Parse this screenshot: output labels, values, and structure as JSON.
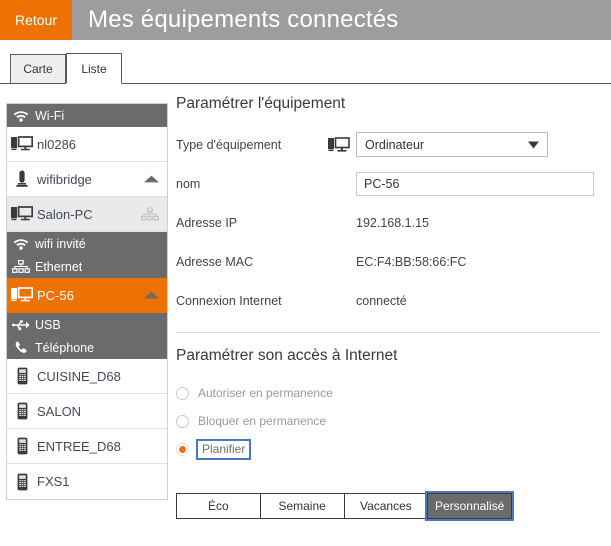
{
  "header": {
    "back_label": "Retour",
    "title": "Mes équipements connectés",
    "back_bg": "#ee7203",
    "bar_bg": "#9d9d9d"
  },
  "tabs": {
    "items": [
      {
        "label": "Carte",
        "active": false
      },
      {
        "label": "Liste",
        "active": true
      }
    ]
  },
  "sidebar": {
    "items": [
      {
        "label": "Wi-Fi",
        "icon": "wifi-icon",
        "kind": "group"
      },
      {
        "label": "nl0286",
        "icon": "computer-icon",
        "kind": "device"
      },
      {
        "label": "wifibridge",
        "icon": "bridge-icon",
        "kind": "device",
        "caret": "up"
      },
      {
        "label": "Salon-PC",
        "icon": "computer-icon",
        "kind": "device",
        "shade": true,
        "badge": "network-icon"
      },
      {
        "label": "wifi invité",
        "icon": "wifi-icon",
        "kind": "group"
      },
      {
        "label": "Ethernet",
        "icon": "network-icon",
        "kind": "group"
      },
      {
        "label": "PC-56",
        "icon": "computer-icon",
        "kind": "device",
        "selected": true,
        "caret": "up"
      },
      {
        "label": "USB",
        "icon": "usb-icon",
        "kind": "group"
      },
      {
        "label": "Téléphone",
        "icon": "phone-icon",
        "kind": "group"
      },
      {
        "label": "CUISINE_D68",
        "icon": "handset-icon",
        "kind": "device"
      },
      {
        "label": "SALON",
        "icon": "handset-icon",
        "kind": "device"
      },
      {
        "label": "ENTREE_D68",
        "icon": "handset-icon",
        "kind": "device"
      },
      {
        "label": "FXS1",
        "icon": "handset-icon",
        "kind": "device",
        "last": true
      }
    ]
  },
  "equipment": {
    "section_title": "Paramétrer l'équipement",
    "type_label": "Type d'équipement",
    "type_value": "Ordinateur",
    "type_options": [
      "Ordinateur"
    ],
    "name_label": "nom",
    "name_value": "PC-56",
    "name_placeholder": "",
    "ip_label": "Adresse IP",
    "ip_value": "192.168.1.15",
    "mac_label": "Adresse MAC",
    "mac_value": "EC:F4:BB:58:66:FC",
    "conn_label": "Connexion Internet",
    "conn_value": "connecté"
  },
  "internet": {
    "section_title": "Paramétrer son accès à Internet",
    "options": [
      {
        "label": "Autoriser en permanence",
        "selected": false
      },
      {
        "label": "Bloquer en permanence",
        "selected": false
      },
      {
        "label": "Planifier",
        "selected": true
      }
    ],
    "schedule_tabs": [
      {
        "label": "Éco",
        "active": false
      },
      {
        "label": "Semaine",
        "active": false
      },
      {
        "label": "Vacances",
        "active": false
      },
      {
        "label": "Personnalisé",
        "active": true
      }
    ]
  },
  "colors": {
    "accent": "#ee7203",
    "focus": "#4a79c4",
    "group_bg": "#6b6b6b"
  }
}
